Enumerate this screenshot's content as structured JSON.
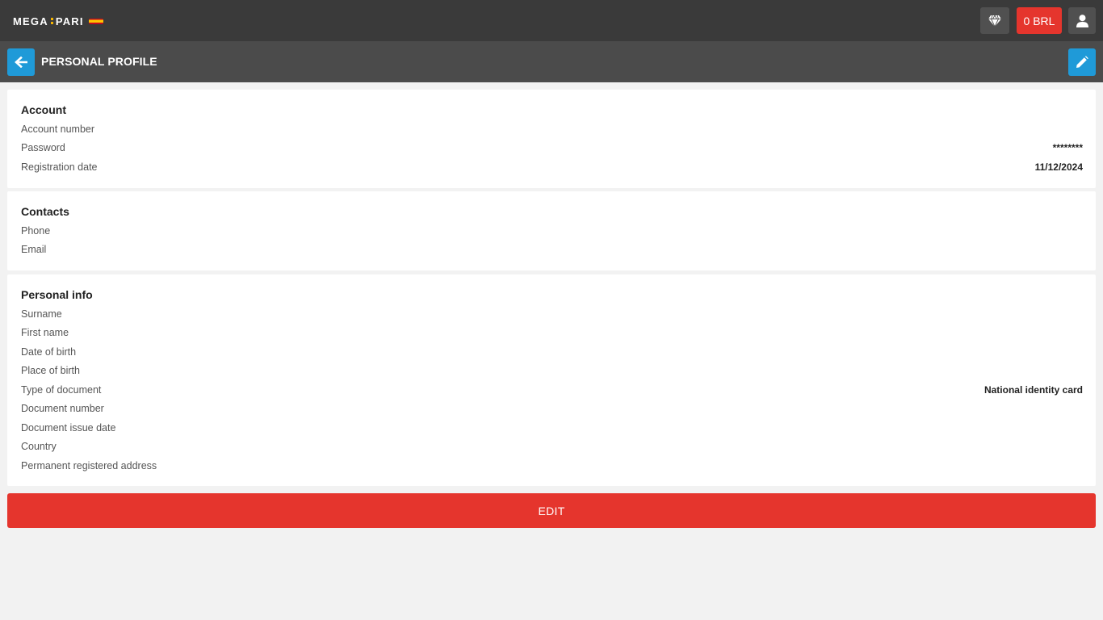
{
  "header": {
    "logo_left": "MEGA",
    "logo_right": "PARI",
    "balance": "0 BRL",
    "icons": [
      "diamond-icon",
      "user-icon",
      "flag-icon"
    ]
  },
  "subheader": {
    "title": "PERSONAL PROFILE",
    "icons": [
      "arrow-left-icon",
      "pencil-icon"
    ]
  },
  "account": {
    "title": "Account",
    "rows": [
      {
        "label": "Account number",
        "value": ""
      },
      {
        "label": "Password",
        "value": "********"
      },
      {
        "label": "Registration date",
        "value": "11/12/2024"
      }
    ]
  },
  "contacts": {
    "title": "Contacts",
    "rows": [
      {
        "label": "Phone",
        "value": ""
      },
      {
        "label": "Email",
        "value": ""
      }
    ]
  },
  "personal": {
    "title": "Personal info",
    "rows": [
      {
        "label": "Surname",
        "value": ""
      },
      {
        "label": "First name",
        "value": ""
      },
      {
        "label": "Date of birth",
        "value": ""
      },
      {
        "label": "Place of birth",
        "value": ""
      },
      {
        "label": "Type of document",
        "value": "National identity card"
      },
      {
        "label": "Document number",
        "value": ""
      },
      {
        "label": "Document issue date",
        "value": ""
      },
      {
        "label": "Country",
        "value": ""
      },
      {
        "label": "Permanent registered address",
        "value": ""
      }
    ]
  },
  "actions": {
    "edit_label": "EDIT"
  },
  "colors": {
    "topbar": "#3a3a3a",
    "subbar": "#4b4b4b",
    "accent_blue": "#1f9ad8",
    "accent_red": "#e5352d",
    "logo_gold": "#f5b400"
  }
}
